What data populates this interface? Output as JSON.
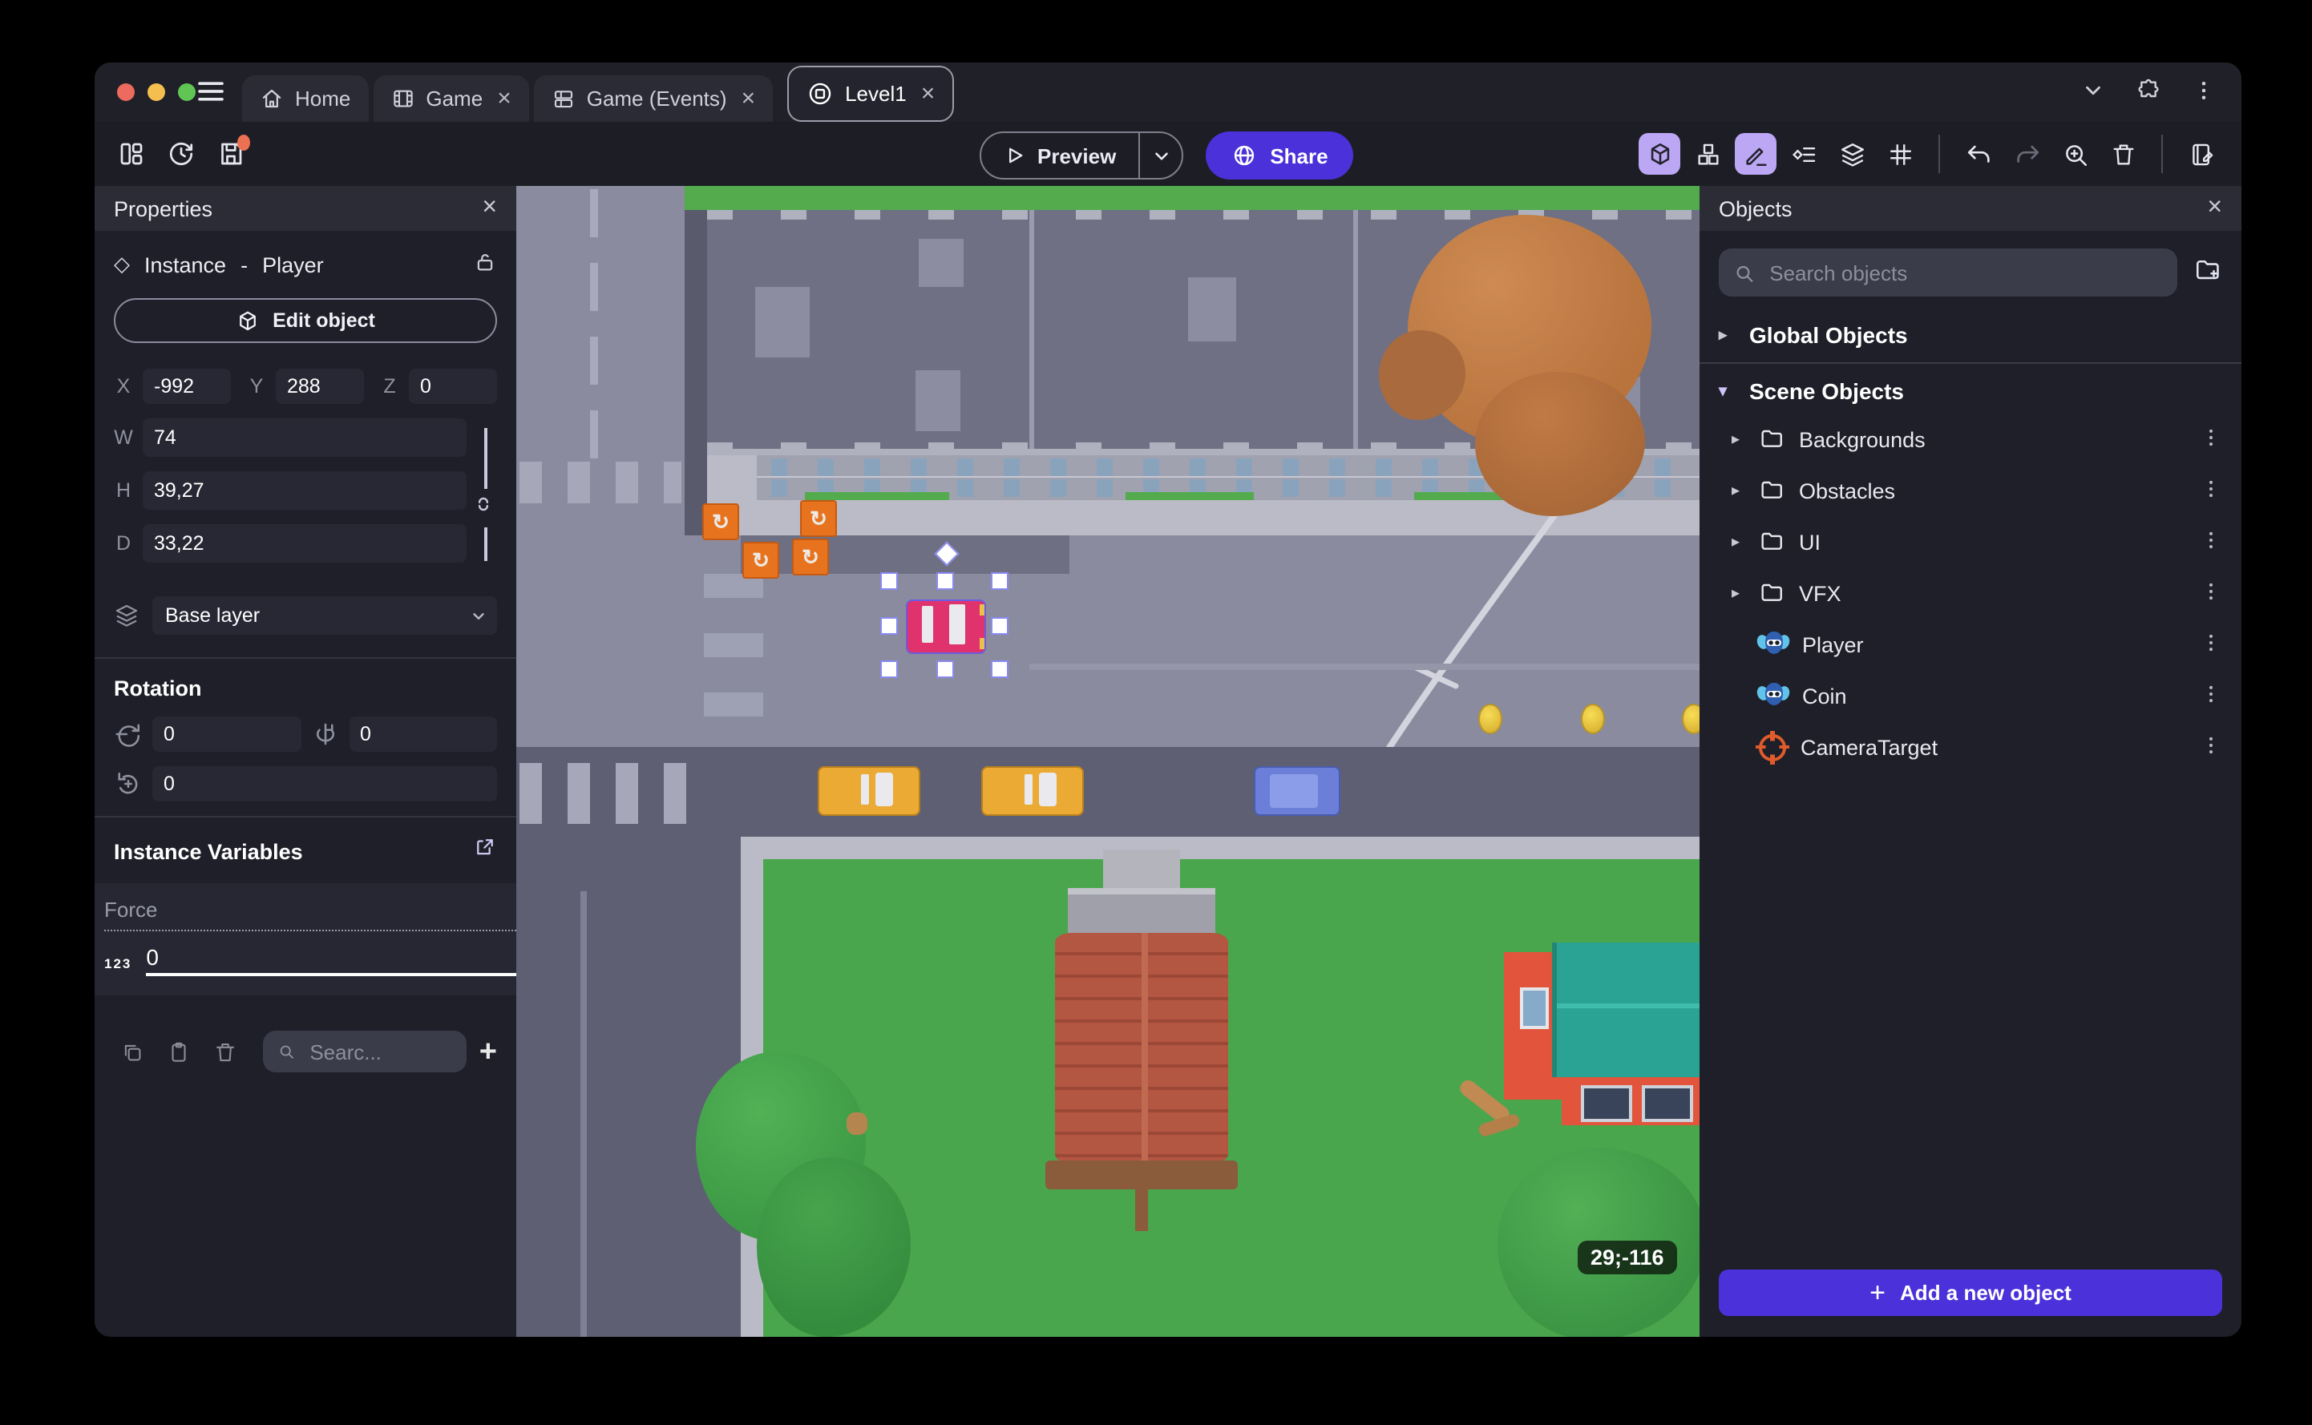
{
  "browser": {
    "tabs": [
      {
        "label": "Home"
      },
      {
        "label": "Game"
      },
      {
        "label": "Game (Events)"
      },
      {
        "label": "Level1"
      }
    ]
  },
  "toolbar": {
    "preview_label": "Preview",
    "share_label": "Share"
  },
  "properties": {
    "title": "Properties",
    "instance_type": "Instance",
    "dash": "-",
    "instance_name": "Player",
    "edit_object_label": "Edit object",
    "x_label": "X",
    "x_value": "-992",
    "y_label": "Y",
    "y_value": "288",
    "z_label": "Z",
    "z_value": "0",
    "w_label": "W",
    "w_value": "74",
    "h_label": "H",
    "h_value": "39,27",
    "d_label": "D",
    "d_value": "33,22",
    "layer_value": "Base layer",
    "rotation_title": "Rotation",
    "rot_x_value": "0",
    "rot_y_value": "0",
    "rot_z_value": "0",
    "variables_title": "Instance Variables",
    "force_label": "Force",
    "force_type": "123",
    "force_value": "0",
    "search_placeholder": "Searc..."
  },
  "objects": {
    "title": "Objects",
    "search_placeholder": "Search objects",
    "global_group_label": "Global Objects",
    "scene_group_label": "Scene Objects",
    "folders": [
      "Backgrounds",
      "Obstacles",
      "UI",
      "VFX"
    ],
    "items": [
      {
        "name": "Player",
        "icon": "monkey"
      },
      {
        "name": "Coin",
        "icon": "monkey"
      },
      {
        "name": "CameraTarget",
        "icon": "target"
      }
    ],
    "add_button_label": "Add a new object"
  },
  "canvas": {
    "coords_badge": "29;-116"
  },
  "glyphs": {
    "close": "×",
    "tri_right": "▸",
    "tri_down": "▾",
    "diamond": "◇",
    "plus": "+",
    "boost_arrow": "↻"
  },
  "colors": {
    "accent_purple": "#4b31d9",
    "active_tool_bg": "#bca7f5",
    "unsaved_dot_orange": "#ec7052",
    "traffic_red": "#ec6a5e",
    "traffic_yellow": "#f4bf4f",
    "traffic_green": "#61c554",
    "selection_pink_car": "#e0336e",
    "camera_target_orange": "#e05b2b"
  }
}
